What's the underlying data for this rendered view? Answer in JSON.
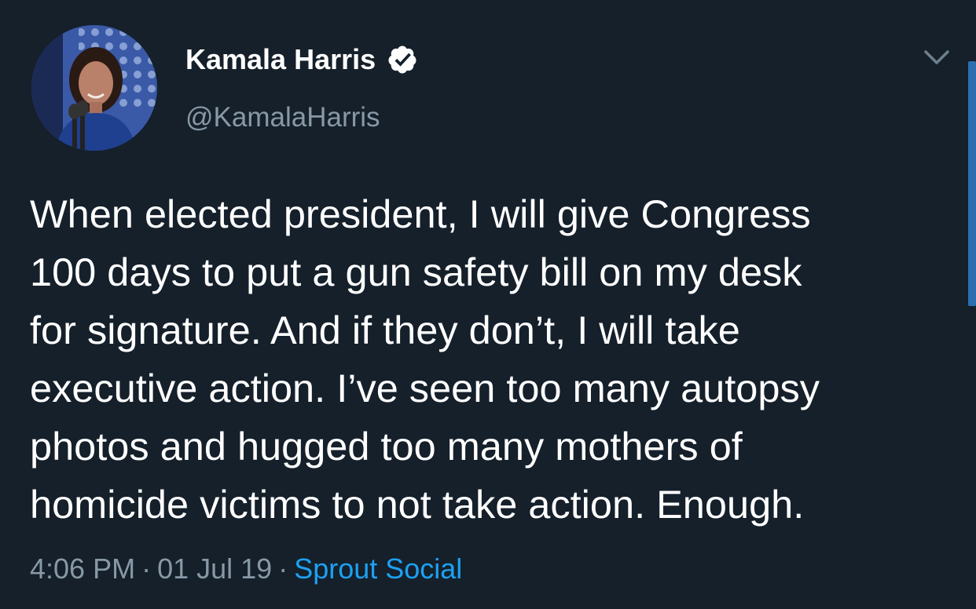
{
  "tweet": {
    "display_name": "Kamala Harris",
    "handle": "@KamalaHarris",
    "text_lines": [
      "When elected president, I will give Congress",
      "100 days to put a gun safety bill on my desk",
      "for signature. And if they don’t, I will take",
      "executive action. I’ve seen too many autopsy",
      "photos and hugged too many mothers of",
      "homicide victims to not take action. Enough."
    ],
    "time": "4:06 PM",
    "separator": "·",
    "date": "01 Jul 19",
    "source": "Sprout Social"
  },
  "icons": {
    "verified": "verified-badge-icon",
    "menu": "chevron-down-icon"
  },
  "colors": {
    "background": "#15202b",
    "secondary_text": "#8899a6",
    "link": "#1da1f2",
    "primary_text": "#ffffff"
  }
}
